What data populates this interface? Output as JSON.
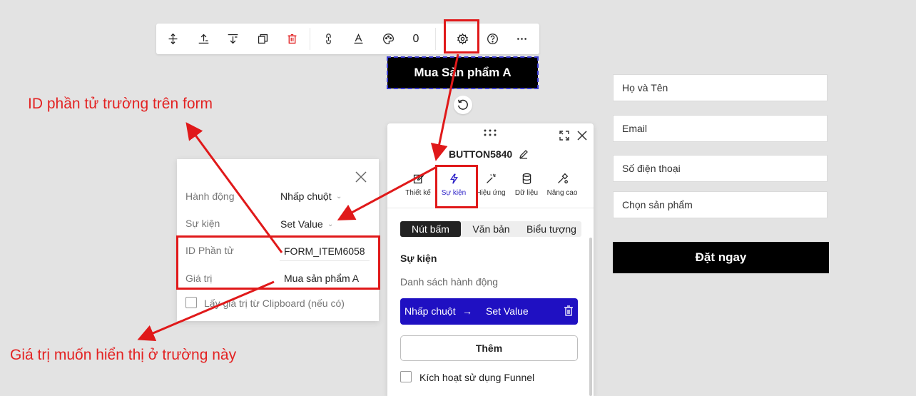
{
  "toolbar": {
    "items": [
      "move-vertical-icon",
      "align-top-icon",
      "align-bottom-icon",
      "copy-icon",
      "trash-icon",
      "link-icon",
      "text-color-icon",
      "palette-icon",
      "count",
      "gear-icon",
      "help-icon",
      "more-icon"
    ],
    "count": "0",
    "delete_color": "#e0191a"
  },
  "canvas": {
    "selected_button_label": "Mua Sản phẩm A"
  },
  "form_preview": {
    "fields": [
      "Họ và Tên",
      "Email",
      "Số điện thoại",
      "Chọn sản phẩm"
    ],
    "submit_label": "Đặt ngay"
  },
  "panel": {
    "title": "BUTTON5840",
    "tabs": [
      {
        "label": "Thiết kế",
        "icon": "edit-icon"
      },
      {
        "label": "Sự kiện",
        "icon": "lightning-icon",
        "active": true
      },
      {
        "label": "Hiệu ứng",
        "icon": "magic-wand-icon"
      },
      {
        "label": "Dữ liệu",
        "icon": "database-icon"
      },
      {
        "label": "Nâng cao",
        "icon": "advanced-icon"
      }
    ],
    "segments": [
      "Nút bấm",
      "Văn bản",
      "Biểu tượng"
    ],
    "active_segment": "Nút bấm",
    "section_title": "Sự kiện",
    "section_subtitle": "Danh sách hành động",
    "action": {
      "trigger": "Nhấp chuột",
      "arrow": "→",
      "type": "Set Value"
    },
    "add_label": "Thêm",
    "funnel_label": "Kích hoạt sử dụng Funnel",
    "accent_color": "#1f10c2"
  },
  "popup": {
    "action_label": "Hành động",
    "action_value": "Nhấp chuột",
    "event_label": "Sự kiện",
    "event_value": "Set Value",
    "id_label": "ID Phần tử",
    "id_value": "FORM_ITEM6058",
    "value_label": "Giá trị",
    "value_value": "Mua sản phẩm A",
    "clipboard_label": "Lấy giá trị từ Clipboard (nếu có)"
  },
  "annotations": {
    "id_note": "ID phần tử trường trên form",
    "value_note": "Giá trị muốn hiển thị ở trường này",
    "color": "#e32222"
  }
}
